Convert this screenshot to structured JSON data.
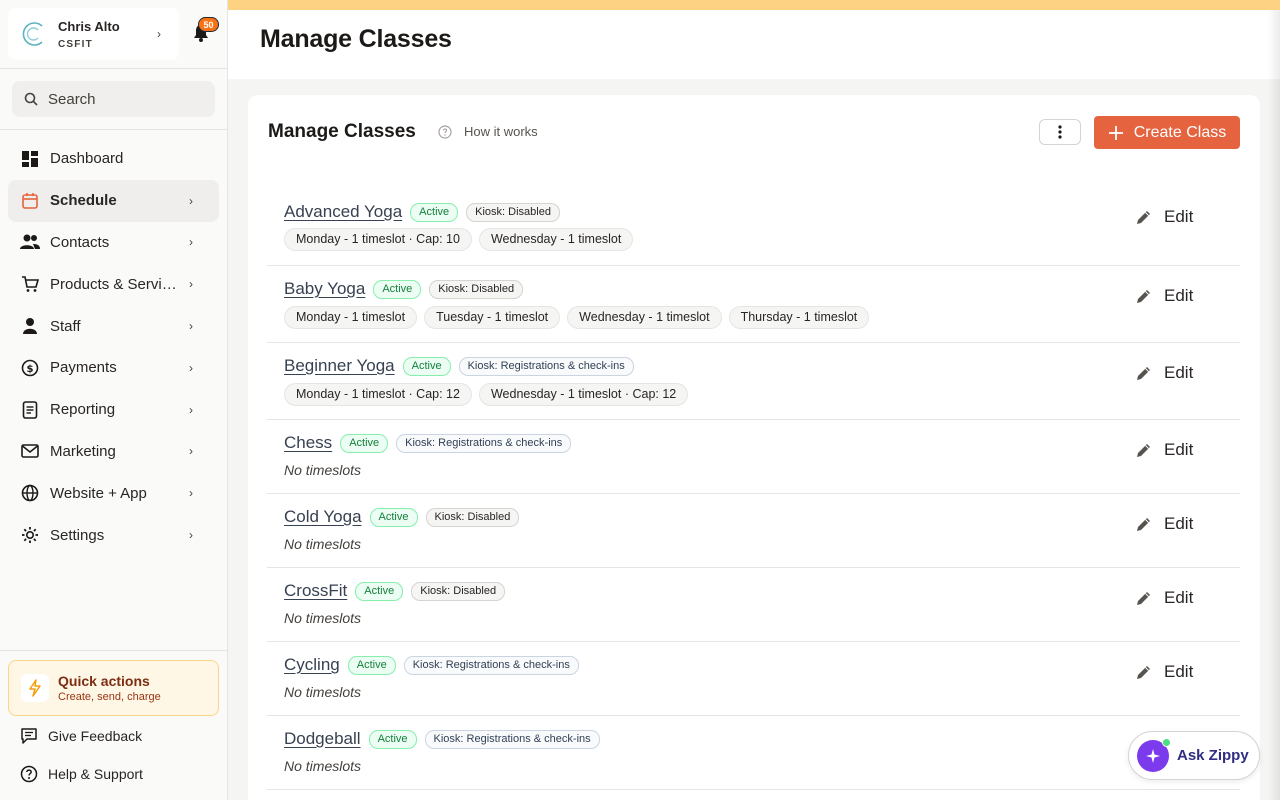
{
  "account": {
    "name": "Chris Alto",
    "org": "CSFIT",
    "notifications": "50"
  },
  "search": {
    "placeholder": "Search"
  },
  "sidebar": {
    "items": [
      {
        "label": "Dashboard"
      },
      {
        "label": "Schedule"
      },
      {
        "label": "Contacts"
      },
      {
        "label": "Products & Services"
      },
      {
        "label": "Staff"
      },
      {
        "label": "Payments"
      },
      {
        "label": "Reporting"
      },
      {
        "label": "Marketing"
      },
      {
        "label": "Website + App"
      },
      {
        "label": "Settings"
      }
    ],
    "active": "Schedule"
  },
  "quick_actions": {
    "title": "Quick actions",
    "subtitle": "Create, send, charge"
  },
  "footer": {
    "feedback": "Give Feedback",
    "help": "Help & Support"
  },
  "header": {
    "title": "Manage Classes"
  },
  "card": {
    "title": "Manage Classes",
    "how_it_works": "How it works",
    "create_button": "Create Class",
    "edit_label": "Edit",
    "active_label": "Active",
    "no_timeslots": "No timeslots"
  },
  "classes": [
    {
      "name": "Advanced Yoga",
      "status": "Active",
      "kiosk": "Kiosk: Disabled",
      "slots": [
        "Monday - 1 timeslot · Cap: 10",
        "Wednesday - 1 timeslot"
      ]
    },
    {
      "name": "Baby Yoga",
      "status": "Active",
      "kiosk": "Kiosk: Disabled",
      "slots": [
        "Monday - 1 timeslot",
        "Tuesday - 1 timeslot",
        "Wednesday - 1 timeslot",
        "Thursday - 1 timeslot"
      ]
    },
    {
      "name": "Beginner Yoga",
      "status": "Active",
      "kiosk": "Kiosk: Registrations & check-ins",
      "slots": [
        "Monday - 1 timeslot · Cap: 12",
        "Wednesday - 1 timeslot · Cap: 12"
      ]
    },
    {
      "name": "Chess",
      "status": "Active",
      "kiosk": "Kiosk: Registrations & check-ins",
      "slots": []
    },
    {
      "name": "Cold Yoga",
      "status": "Active",
      "kiosk": "Kiosk: Disabled",
      "slots": []
    },
    {
      "name": "CrossFit",
      "status": "Active",
      "kiosk": "Kiosk: Disabled",
      "slots": []
    },
    {
      "name": "Cycling",
      "status": "Active",
      "kiosk": "Kiosk: Registrations & check-ins",
      "slots": []
    },
    {
      "name": "Dodgeball",
      "status": "Active",
      "kiosk": "Kiosk: Registrations & check-ins",
      "slots": []
    }
  ],
  "assistant": {
    "label": "Ask Zippy"
  },
  "colors": {
    "accent": "#e5643f",
    "active_green": "#15803d",
    "top_strip": "#fdd283",
    "assistant": "#7c3aed"
  }
}
